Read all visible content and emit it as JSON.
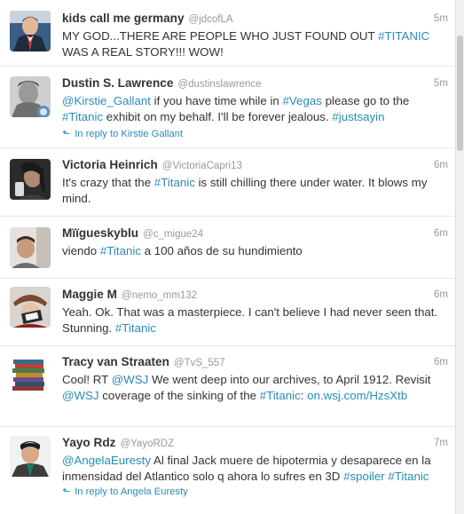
{
  "tweets": [
    {
      "name": "kids call me germany",
      "handle": "@jdcofLA",
      "time": "5m",
      "segments": [
        {
          "text": "MY GOD...THERE ARE PEOPLE WHO JUST FOUND OUT ",
          "tag": false
        },
        {
          "text": "#TITANIC",
          "tag": true
        },
        {
          "text": " WAS A REAL STORY!!! WOW!",
          "tag": false
        }
      ],
      "reply": ""
    },
    {
      "name": "Dustin S. Lawrence",
      "handle": "@dustinslawrence",
      "time": "5m",
      "segments": [
        {
          "text": "@Kirstie_Gallant",
          "tag": true
        },
        {
          "text": " if you have time while in ",
          "tag": false
        },
        {
          "text": "#Vegas",
          "tag": true
        },
        {
          "text": " please go to the ",
          "tag": false
        },
        {
          "text": "#Titanic",
          "tag": true
        },
        {
          "text": " exhibit on my behalf. I'll be forever jealous. ",
          "tag": false
        },
        {
          "text": "#justsayin",
          "tag": true
        }
      ],
      "reply": "In reply to Kirstie Gallant"
    },
    {
      "name": "Victoria Heinrich",
      "handle": "@VictoriaCapri13",
      "time": "6m",
      "segments": [
        {
          "text": "It's crazy that the ",
          "tag": false
        },
        {
          "text": "#Titanic",
          "tag": true
        },
        {
          "text": " is still chilling there under water. It blows my mind.",
          "tag": false
        }
      ],
      "reply": ""
    },
    {
      "name": "Mïïgueskyblu",
      "handle": "@c_migue24",
      "time": "6m",
      "segments": [
        {
          "text": "viendo ",
          "tag": false
        },
        {
          "text": "#Titanic",
          "tag": true
        },
        {
          "text": " a 100 años de su hundimiento",
          "tag": false
        }
      ],
      "reply": ""
    },
    {
      "name": "Maggie M",
      "handle": "@nemo_mm132",
      "time": "6m",
      "segments": [
        {
          "text": "Yeah. Ok. That was a masterpiece. I can't believe I had never seen that. Stunning. ",
          "tag": false
        },
        {
          "text": "#Titanic",
          "tag": true
        }
      ],
      "reply": ""
    },
    {
      "name": "Tracy van Straaten",
      "handle": "@TvS_557",
      "time": "6m",
      "segments": [
        {
          "text": "Cool! RT ",
          "tag": false
        },
        {
          "text": "@WSJ",
          "tag": true
        },
        {
          "text": " We went deep into our archives, to April 1912. Revisit ",
          "tag": false
        },
        {
          "text": "@WSJ",
          "tag": true
        },
        {
          "text": " coverage of the sinking of the ",
          "tag": false
        },
        {
          "text": "#Titanic",
          "tag": true
        },
        {
          "text": ": ",
          "tag": false
        },
        {
          "text": "on.wsj.com/HzsXtb",
          "tag": true
        }
      ],
      "reply": ""
    },
    {
      "name": "Yayo Rdz",
      "handle": "@YayoRDZ",
      "time": "7m",
      "segments": [
        {
          "text": "@AngelaEuresty",
          "tag": true
        },
        {
          "text": " Al final Jack muere de hipotermia y desaparece en la inmensidad del Atlantico solo q ahora lo sufres en 3D ",
          "tag": false
        },
        {
          "text": "#spoiler",
          "tag": true
        },
        {
          "text": " ",
          "tag": false
        },
        {
          "text": "#Titanic",
          "tag": true
        }
      ],
      "reply": "In reply to Angela Euresty"
    }
  ],
  "colors": {
    "link": "#2a8ab8",
    "muted": "#999999",
    "text": "#333333"
  },
  "icons": {
    "reply": "reply-arrow-icon"
  }
}
